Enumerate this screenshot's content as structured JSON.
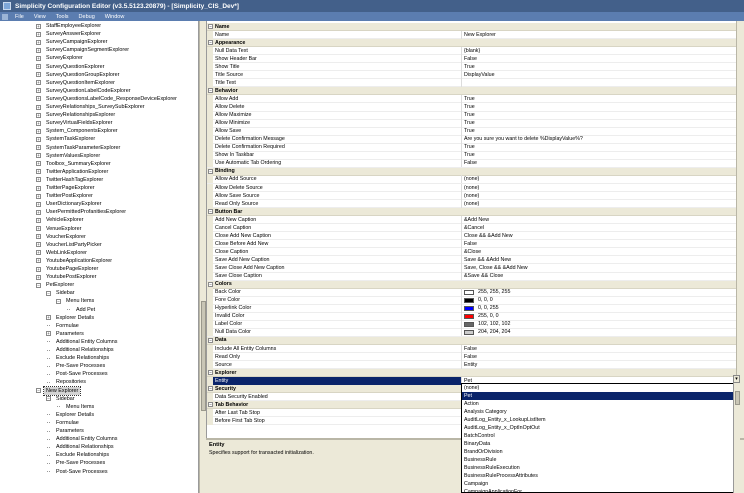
{
  "window": {
    "title": "Simplicity Configuration Editor (v3.5.5123.20879) - [Simplicity_CIS_Dev*]"
  },
  "menu": [
    "File",
    "View",
    "Tools",
    "Debug",
    "Window"
  ],
  "tree": [
    {
      "label": "StaffEmployeeExplorer",
      "indent": 0,
      "type": "plus"
    },
    {
      "label": "SurveyAnswerExplorer",
      "indent": 0,
      "type": "plus"
    },
    {
      "label": "SurveyCampaignExplorer",
      "indent": 0,
      "type": "plus"
    },
    {
      "label": "SurveyCampaignSegmentExplorer",
      "indent": 0,
      "type": "plus"
    },
    {
      "label": "SurveyExplorer",
      "indent": 0,
      "type": "plus"
    },
    {
      "label": "SurveyQuestionExplorer",
      "indent": 0,
      "type": "plus"
    },
    {
      "label": "SurveyQuestionGroupExplorer",
      "indent": 0,
      "type": "plus"
    },
    {
      "label": "SurveyQuestionItemExplorer",
      "indent": 0,
      "type": "plus"
    },
    {
      "label": "SurveyQuestionLabelCodeExplorer",
      "indent": 0,
      "type": "plus"
    },
    {
      "label": "SurveyQuestionsLabelCode_ResponseDeviceExplorer",
      "indent": 0,
      "type": "plus"
    },
    {
      "label": "SurveyRelationships_SurveySubExplorer",
      "indent": 0,
      "type": "plus"
    },
    {
      "label": "SurveyRelationshipsExplorer",
      "indent": 0,
      "type": "plus"
    },
    {
      "label": "SurveyVirtualFieldsExplorer",
      "indent": 0,
      "type": "plus"
    },
    {
      "label": "System_ComponentsExplorer",
      "indent": 0,
      "type": "plus"
    },
    {
      "label": "SystemTaskExplorer",
      "indent": 0,
      "type": "plus"
    },
    {
      "label": "SystemTaskParameterExplorer",
      "indent": 0,
      "type": "plus"
    },
    {
      "label": "SystemValuesExplorer",
      "indent": 0,
      "type": "plus"
    },
    {
      "label": "Toolbox_SummaryExplorer",
      "indent": 0,
      "type": "plus"
    },
    {
      "label": "TwitterApplicationExplorer",
      "indent": 0,
      "type": "plus"
    },
    {
      "label": "TwitterHashTagExplorer",
      "indent": 0,
      "type": "plus"
    },
    {
      "label": "TwitterPageExplorer",
      "indent": 0,
      "type": "plus"
    },
    {
      "label": "TwitterPostExplorer",
      "indent": 0,
      "type": "plus"
    },
    {
      "label": "UserDictionaryExplorer",
      "indent": 0,
      "type": "plus"
    },
    {
      "label": "UserPermittedProfanitiesExplorer",
      "indent": 0,
      "type": "plus"
    },
    {
      "label": "VehicleExplorer",
      "indent": 0,
      "type": "plus"
    },
    {
      "label": "VenueExplorer",
      "indent": 0,
      "type": "plus"
    },
    {
      "label": "VoucherExplorer",
      "indent": 0,
      "type": "plus"
    },
    {
      "label": "VoucherListPartyPicker",
      "indent": 0,
      "type": "plus"
    },
    {
      "label": "WebLinkExplorer",
      "indent": 0,
      "type": "plus"
    },
    {
      "label": "YoutubeApplicationExplorer",
      "indent": 0,
      "type": "plus"
    },
    {
      "label": "YoutubePageExplorer",
      "indent": 0,
      "type": "plus"
    },
    {
      "label": "YoutubePostExplorer",
      "indent": 0,
      "type": "plus"
    },
    {
      "label": "PetExplorer",
      "indent": 0,
      "type": "minus"
    },
    {
      "label": "Sidebar",
      "indent": 1,
      "type": "minus"
    },
    {
      "label": "Menu Items",
      "indent": 2,
      "type": "minus"
    },
    {
      "label": "Add Pet",
      "indent": 3,
      "type": "leaf"
    },
    {
      "label": "Explorer Details",
      "indent": 1,
      "type": "plus"
    },
    {
      "label": "Formulae",
      "indent": 1,
      "type": "leaf"
    },
    {
      "label": "Parameters",
      "indent": 1,
      "type": "plus"
    },
    {
      "label": "Additional Entity Columns",
      "indent": 1,
      "type": "leaf"
    },
    {
      "label": "Additional Relationships",
      "indent": 1,
      "type": "leaf"
    },
    {
      "label": "Exclude Relationships",
      "indent": 1,
      "type": "leaf"
    },
    {
      "label": "Pre-Save Processes",
      "indent": 1,
      "type": "leaf"
    },
    {
      "label": "Post-Save Processes",
      "indent": 1,
      "type": "leaf"
    },
    {
      "label": "Repositories",
      "indent": 1,
      "type": "leaf"
    },
    {
      "label": "New Explorer",
      "indent": 0,
      "type": "minus",
      "selected": true
    },
    {
      "label": "Sidebar",
      "indent": 1,
      "type": "minus"
    },
    {
      "label": "Menu Items",
      "indent": 2,
      "type": "leaf"
    },
    {
      "label": "Explorer Details",
      "indent": 1,
      "type": "leaf"
    },
    {
      "label": "Formulae",
      "indent": 1,
      "type": "leaf"
    },
    {
      "label": "Parameters",
      "indent": 1,
      "type": "leaf"
    },
    {
      "label": "Additional Entity Columns",
      "indent": 1,
      "type": "leaf"
    },
    {
      "label": "Additional Relationships",
      "indent": 1,
      "type": "leaf"
    },
    {
      "label": "Exclude Relationships",
      "indent": 1,
      "type": "leaf"
    },
    {
      "label": "Pre-Save Processes",
      "indent": 1,
      "type": "leaf"
    },
    {
      "label": "Post-Save Processes",
      "indent": 1,
      "type": "leaf"
    }
  ],
  "grid": [
    {
      "category": "Name"
    },
    {
      "name": "Name",
      "value": "New Explorer"
    },
    {
      "category": "Appearance"
    },
    {
      "name": "Null Data Text",
      "value": "{blank}"
    },
    {
      "name": "Show Header Bar",
      "value": "False"
    },
    {
      "name": "Show Title",
      "value": "True"
    },
    {
      "name": "Title Source",
      "value": "DisplayValue"
    },
    {
      "name": "Title Text",
      "value": ""
    },
    {
      "category": "Behavior"
    },
    {
      "name": "Allow Add",
      "value": "True"
    },
    {
      "name": "Allow Delete",
      "value": "True"
    },
    {
      "name": "Allow Maximize",
      "value": "True"
    },
    {
      "name": "Allow Minimize",
      "value": "True"
    },
    {
      "name": "Allow Save",
      "value": "True"
    },
    {
      "name": "Delete Confirmation Message",
      "value": "Are you sure you want to delete %DisplayValue%?"
    },
    {
      "name": "Delete Confirmation Required",
      "value": "True"
    },
    {
      "name": "Show In Taskbar",
      "value": "True"
    },
    {
      "name": "Use Automatic Tab Ordering",
      "value": "False"
    },
    {
      "category": "Binding"
    },
    {
      "name": "Allow Add Source",
      "value": "(none)"
    },
    {
      "name": "Allow Delete Source",
      "value": "(none)"
    },
    {
      "name": "Allow Save Source",
      "value": "(none)"
    },
    {
      "name": "Read Only Source",
      "value": "(none)"
    },
    {
      "category": "Button Bar"
    },
    {
      "name": "Add New Caption",
      "value": "&Add New"
    },
    {
      "name": "Cancel Caption",
      "value": "&Cancel"
    },
    {
      "name": "Close Add New Caption",
      "value": "Close && &Add New"
    },
    {
      "name": "Close Before Add New",
      "value": "False"
    },
    {
      "name": "Close Caption",
      "value": "&Close"
    },
    {
      "name": "Save Add New Caption",
      "value": "Save && &Add New"
    },
    {
      "name": "Save Close Add New Caption",
      "value": "Save, Close && &Add New"
    },
    {
      "name": "Save Close Caption",
      "value": "&Save && Close"
    },
    {
      "category": "Colors"
    },
    {
      "name": "Back Color",
      "value": "255, 255, 255",
      "swatch": "#ffffff"
    },
    {
      "name": "Fore Color",
      "value": "0, 0, 0",
      "swatch": "#000000"
    },
    {
      "name": "Hyperlink Color",
      "value": "0, 0, 255",
      "swatch": "#0000ff"
    },
    {
      "name": "Invalid Color",
      "value": "255, 0, 0",
      "swatch": "#ff0000"
    },
    {
      "name": "Label Color",
      "value": "102, 102, 102",
      "swatch": "#666666"
    },
    {
      "name": "Null Data Color",
      "value": "204, 204, 204",
      "swatch": "#cccccc"
    },
    {
      "category": "Data"
    },
    {
      "name": "Include All Entity Columns",
      "value": "False"
    },
    {
      "name": "Read Only",
      "value": "False"
    },
    {
      "name": "Source",
      "value": "Entity"
    },
    {
      "category": "Explorer"
    },
    {
      "name": "Entity",
      "value": "Pet",
      "selected": true
    },
    {
      "category": "Security"
    },
    {
      "name": "Data Security Enabled",
      "value": ""
    },
    {
      "category": "Tab Behavior"
    },
    {
      "name": "After Last Tab Stop",
      "value": ""
    },
    {
      "name": "Before First Tab Stop",
      "value": ""
    }
  ],
  "description": {
    "title": "Entity",
    "text": "Specifies support for transacted initialization."
  },
  "dropdown": {
    "options": [
      {
        "label": "(none)"
      },
      {
        "label": "Pet",
        "selected": true
      },
      {
        "label": "Action"
      },
      {
        "label": "Analysis Category"
      },
      {
        "label": "AuditLog_Entity_x_LookupListItem"
      },
      {
        "label": "AuditLog_Entity_x_OptInOptOut"
      },
      {
        "label": "BatchControl"
      },
      {
        "label": "BinaryData"
      },
      {
        "label": "BrandOrDivision"
      },
      {
        "label": "BusinessRule"
      },
      {
        "label": "BusinessRuleExecution"
      },
      {
        "label": "BusinessRuleProcessAttributes"
      },
      {
        "label": "Campaign"
      },
      {
        "label": "CampaignApplicationFor..."
      }
    ]
  }
}
